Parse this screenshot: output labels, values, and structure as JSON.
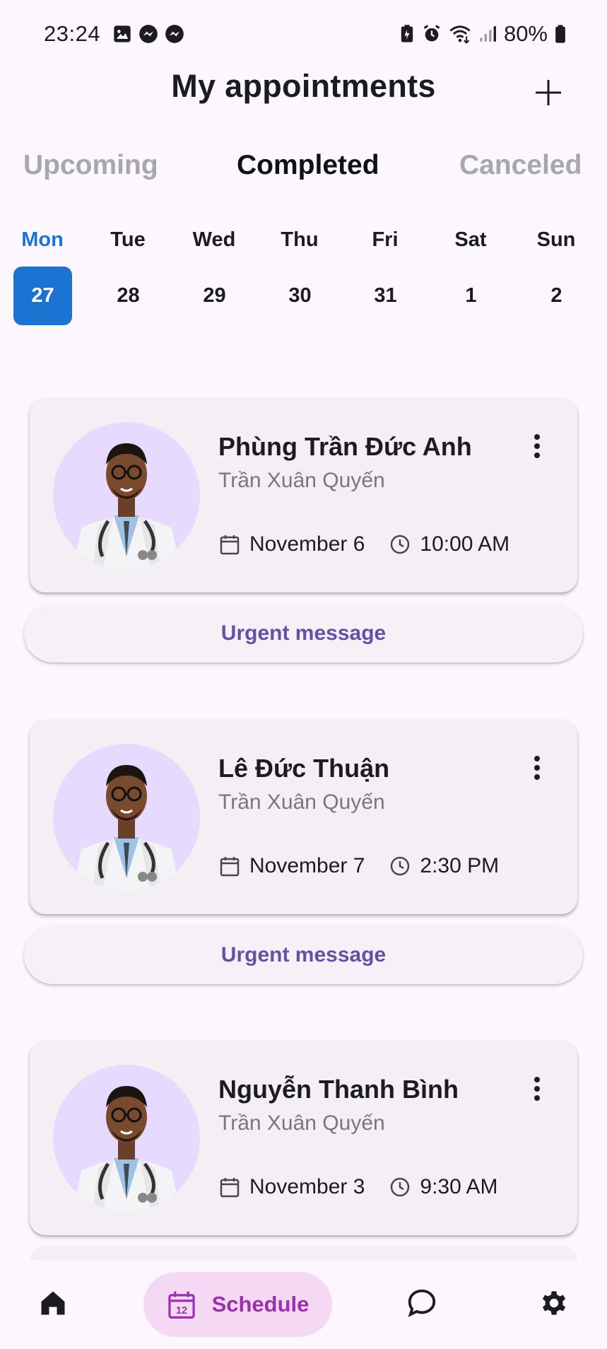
{
  "status_bar": {
    "time": "23:24",
    "left_icons": [
      "gallery-icon",
      "messenger-icon",
      "messenger-icon"
    ],
    "right_icons": [
      "battery-saver-icon",
      "alarm-icon",
      "wifi-icon",
      "signal-icon",
      "battery-icon"
    ],
    "battery": "80%"
  },
  "header": {
    "title": "My appointments",
    "add_icon": "plus-icon"
  },
  "tabs": [
    {
      "label": "Upcoming",
      "active": false
    },
    {
      "label": "Completed",
      "active": true
    },
    {
      "label": "Canceled",
      "active": false
    }
  ],
  "week": [
    {
      "day": "Mon",
      "date": "27",
      "selected": true
    },
    {
      "day": "Tue",
      "date": "28",
      "selected": false
    },
    {
      "day": "Wed",
      "date": "29",
      "selected": false
    },
    {
      "day": "Thu",
      "date": "30",
      "selected": false
    },
    {
      "day": "Fri",
      "date": "31",
      "selected": false
    },
    {
      "day": "Sat",
      "date": "1",
      "selected": false
    },
    {
      "day": "Sun",
      "date": "2",
      "selected": false
    }
  ],
  "appointments": [
    {
      "patient": "Phùng Trần Đức Anh",
      "doctor": "Trần Xuân Quyến",
      "date": "November 6",
      "time": "10:00 AM",
      "action": "Urgent message"
    },
    {
      "patient": "Lê Đức Thuận",
      "doctor": "Trần Xuân Quyến",
      "date": "November 7",
      "time": "2:30 PM",
      "action": "Urgent message"
    },
    {
      "patient": "Nguyễn Thanh Bình",
      "doctor": "Trần Xuân Quyến",
      "date": "November 3",
      "time": "9:30 AM"
    }
  ],
  "bottom_nav": {
    "home_icon": "home-icon",
    "schedule_label": "Schedule",
    "schedule_icon_text": "12",
    "chat_icon": "chat-bubble-icon",
    "settings_icon": "gear-icon"
  },
  "colors": {
    "accent_blue": "#1b74d2",
    "purple_text": "#6750a4",
    "schedule_pill": "#f5d8f3",
    "schedule_text": "#9a2fb0",
    "avatar_bg": "#e6dbff"
  }
}
